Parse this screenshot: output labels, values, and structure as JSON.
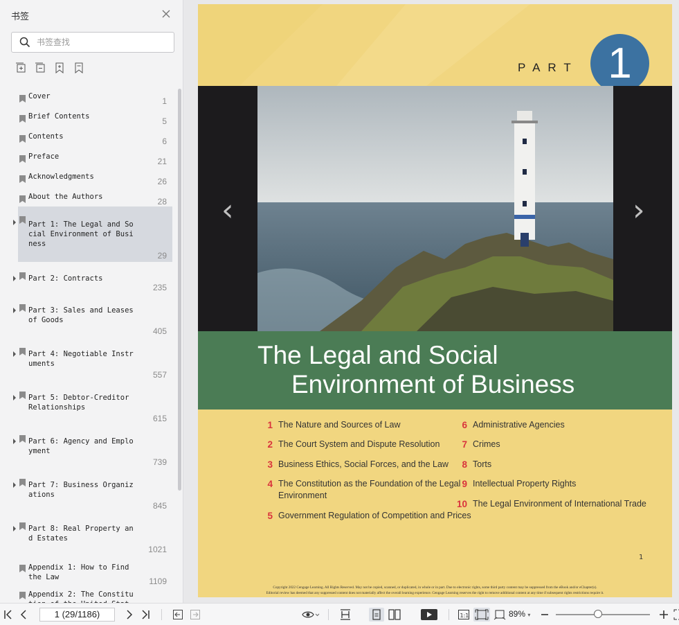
{
  "sidebar": {
    "title": "书签",
    "search_placeholder": "书签查找",
    "items": [
      {
        "label": "Cover",
        "page": "1"
      },
      {
        "label": "Brief Contents",
        "page": "5"
      },
      {
        "label": "Contents",
        "page": "6"
      },
      {
        "label": "Preface",
        "page": "21"
      },
      {
        "label": "Acknowledgments",
        "page": "26"
      },
      {
        "label": "About the Authors",
        "page": "28"
      },
      {
        "label": "Part 1: The Legal and So\ncial Environment of Busi\nness",
        "page": "29"
      },
      {
        "label": "Part 2: Contracts",
        "page": "235"
      },
      {
        "label": "Part 3: Sales and Leases\nof Goods",
        "page": "405"
      },
      {
        "label": "Part 4: Negotiable Instr\numents",
        "page": "557"
      },
      {
        "label": "Part 5: Debtor-Creditor\nRelationships",
        "page": "615"
      },
      {
        "label": "Part 6: Agency and Emplo\nyment",
        "page": "739"
      },
      {
        "label": "Part 7: Business Organiz\nations",
        "page": "845"
      },
      {
        "label": "Part 8: Real Property an\nd Estates",
        "page": "1021"
      },
      {
        "label": "Appendix 1: How to Find\nthe Law",
        "page": "1109"
      },
      {
        "label": "Appendix 2: The Constitu\ntion of the United Stat",
        "page": ""
      }
    ]
  },
  "document": {
    "part_label": "PART",
    "part_number": "1",
    "title_line1": "The Legal and Social",
    "title_line2": "Environment of Business",
    "chapters_left": [
      {
        "num": "1",
        "title": "The Nature and Sources of Law"
      },
      {
        "num": "2",
        "title": "The Court System and Dispute Resolution"
      },
      {
        "num": "3",
        "title": "Business Ethics, Social Forces, and the Law"
      },
      {
        "num": "4",
        "title": "The Constitution as the Foundation of the Legal\nEnvironment"
      },
      {
        "num": "5",
        "title": "Government Regulation of Competition and Prices"
      }
    ],
    "chapters_right": [
      {
        "num": "6",
        "title": "Administrative Agencies"
      },
      {
        "num": "7",
        "title": "Crimes"
      },
      {
        "num": "8",
        "title": "Torts"
      },
      {
        "num": "9",
        "title": "Intellectual Property Rights"
      },
      {
        "num": "10",
        "title": "The Legal Environment of International Trade"
      }
    ],
    "page_number": "1",
    "copyright_line1": "Copyright 2022 Cengage Learning. All Rights Reserved. May not be copied, scanned, or duplicated, in whole or in part. Due to electronic rights, some third party content may be suppressed from the eBook and/or eChapter(s).",
    "copyright_line2": "Editorial review has deemed that any suppressed content does not materially affect the overall learning experience. Cengage Learning reserves the right to remove additional content at any time if subsequent rights restrictions require it."
  },
  "toolbar": {
    "page_indicator": "1 (29/1186)",
    "zoom": "89%",
    "zoom_fraction": 0.45
  },
  "colors": {
    "page_bg": "#f1d680",
    "part_circle": "#3c72a1",
    "title_band": "#4b7c55",
    "chapter_number": "#d9333c"
  }
}
